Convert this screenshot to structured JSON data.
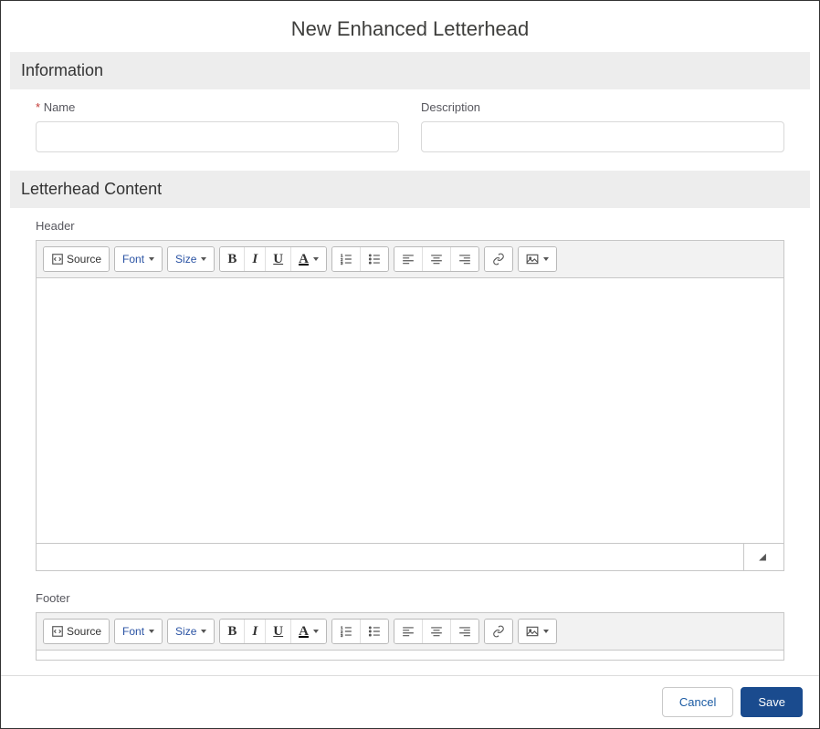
{
  "modal": {
    "title": "New Enhanced Letterhead"
  },
  "sections": {
    "information": {
      "title": "Information"
    },
    "content": {
      "title": "Letterhead Content"
    }
  },
  "fields": {
    "name": {
      "label": "Name",
      "required_marker": "*",
      "value": ""
    },
    "description": {
      "label": "Description",
      "value": ""
    }
  },
  "editors": {
    "header": {
      "label": "Header"
    },
    "footer": {
      "label": "Footer"
    }
  },
  "toolbar": {
    "source": "Source",
    "font": "Font",
    "size": "Size"
  },
  "actions": {
    "cancel": "Cancel",
    "save": "Save"
  }
}
